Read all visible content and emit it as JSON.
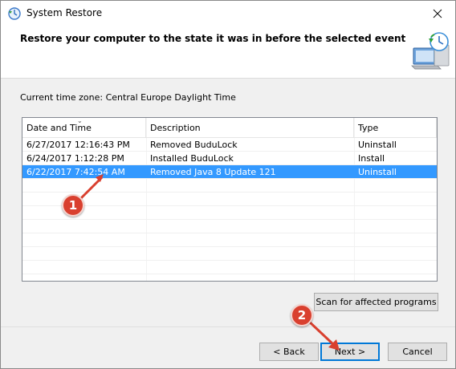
{
  "window": {
    "title": "System Restore",
    "header": "Restore your computer to the state it was in before the selected event"
  },
  "timezone": "Current time zone: Central Europe Daylight Time",
  "table": {
    "columns": [
      "Date and Time",
      "Description",
      "Type"
    ],
    "rows": [
      {
        "datetime": "6/27/2017 12:16:43 PM",
        "description": "Removed BuduLock",
        "type": "Uninstall"
      },
      {
        "datetime": "6/24/2017 1:12:28 PM",
        "description": "Installed BuduLock",
        "type": "Install"
      },
      {
        "datetime": "6/22/2017 7:42:54 AM",
        "description": "Removed Java 8 Update 121",
        "type": "Uninstall"
      }
    ]
  },
  "buttons": {
    "scan": "Scan for affected programs",
    "back": "< Back",
    "next": "Next >",
    "cancel": "Cancel"
  },
  "annotations": {
    "badge1": "1",
    "badge2": "2"
  },
  "colors": {
    "selection": "#3399ff",
    "badge": "#d9402f",
    "primary_border": "#0078d7"
  }
}
